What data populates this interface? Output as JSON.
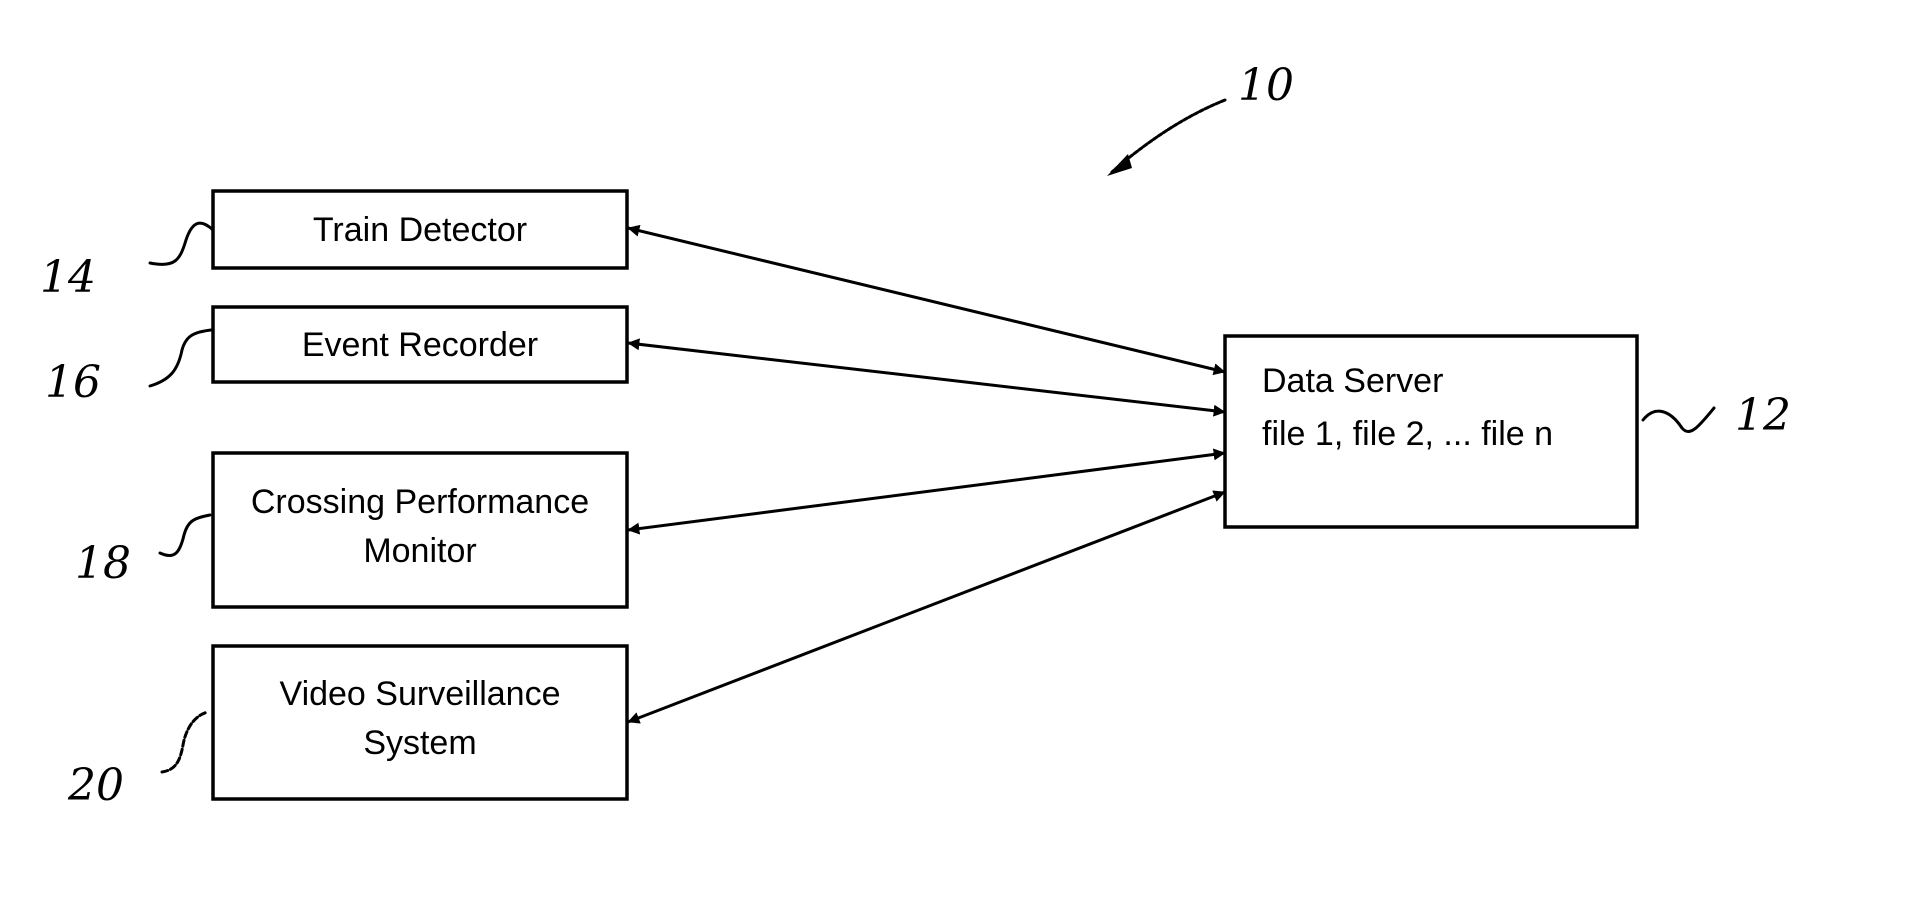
{
  "diagram": {
    "figure_ref": "10",
    "server": {
      "ref": "12",
      "title": "Data Server",
      "subtitle": "file 1, file 2, ...  file n"
    },
    "components": [
      {
        "ref": "14",
        "lines": [
          "Train Detector"
        ]
      },
      {
        "ref": "16",
        "lines": [
          "Event Recorder"
        ]
      },
      {
        "ref": "18",
        "lines": [
          "Crossing Performance",
          "Monitor"
        ]
      },
      {
        "ref": "20",
        "lines": [
          "Video Surveillance",
          "System"
        ]
      }
    ],
    "connections": [
      {
        "from": "14",
        "to": "12",
        "direction": "bidirectional"
      },
      {
        "from": "16",
        "to": "12",
        "direction": "bidirectional"
      },
      {
        "from": "18",
        "to": "12",
        "direction": "bidirectional"
      },
      {
        "from": "20",
        "to": "12",
        "direction": "bidirectional"
      }
    ]
  }
}
